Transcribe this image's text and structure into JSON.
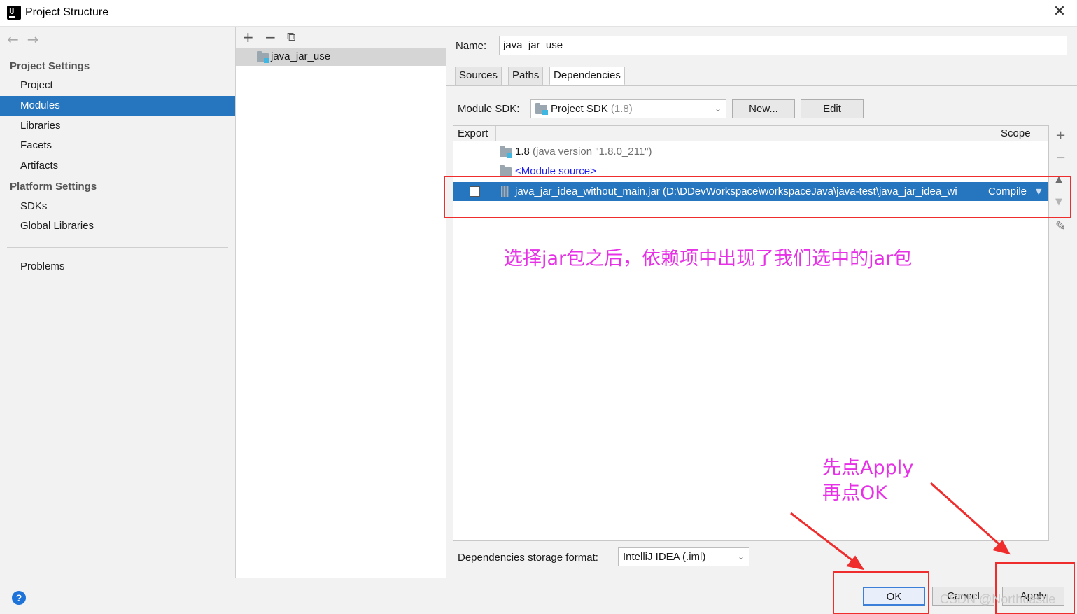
{
  "window": {
    "title": "Project Structure",
    "close": "✕"
  },
  "nav": {
    "back": "←",
    "forward": "→"
  },
  "sidebar": {
    "project_settings_header": "Project Settings",
    "project_settings_items": [
      "Project",
      "Modules",
      "Libraries",
      "Facets",
      "Artifacts"
    ],
    "selected": "Modules",
    "platform_settings_header": "Platform Settings",
    "platform_settings_items": [
      "SDKs",
      "Global Libraries"
    ],
    "problems": "Problems"
  },
  "module_list": {
    "toolbar": {
      "add": "+",
      "remove": "−",
      "copy": "⧉"
    },
    "items": [
      "java_jar_use"
    ]
  },
  "module": {
    "name_label": "Name:",
    "name_value": "java_jar_use",
    "tabs": [
      "Sources",
      "Paths",
      "Dependencies"
    ],
    "active_tab": "Dependencies",
    "sdk_label": "Module SDK:",
    "sdk_value": "Project SDK",
    "sdk_version": "(1.8)",
    "new_button": "New...",
    "edit_button": "Edit",
    "table": {
      "col_export": "Export",
      "col_scope": "Scope",
      "rows": [
        {
          "name": "1.8",
          "detail": "(java version \"1.8.0_211\")"
        },
        {
          "name": "<Module source>"
        },
        {
          "name": "java_jar_idea_without_main.jar (D:\\DDevWorkspace\\workspaceJava\\java-test\\java_jar_idea_wi",
          "scope": "Compile",
          "checked": false
        }
      ]
    },
    "side_tools": {
      "add": "+",
      "remove": "−",
      "up": "▲",
      "down": "▼",
      "edit": "✎"
    },
    "storage_label": "Dependencies storage format:",
    "storage_value": "IntelliJ IDEA (.iml)"
  },
  "footer": {
    "help": "?",
    "ok": "OK",
    "cancel": "Cancel",
    "apply": "Apply"
  },
  "annotations": {
    "dep_note": "选择jar包之后，依赖项中出现了我们选中的jar包",
    "step1": "先点Apply",
    "step2": "再点OK",
    "highlight_color": "#ef2d2d",
    "text_color": "#e631e6"
  },
  "watermark": "CSDN @Northcastle",
  "colors": {
    "selection": "#2675bf",
    "link": "#1d1df0"
  }
}
